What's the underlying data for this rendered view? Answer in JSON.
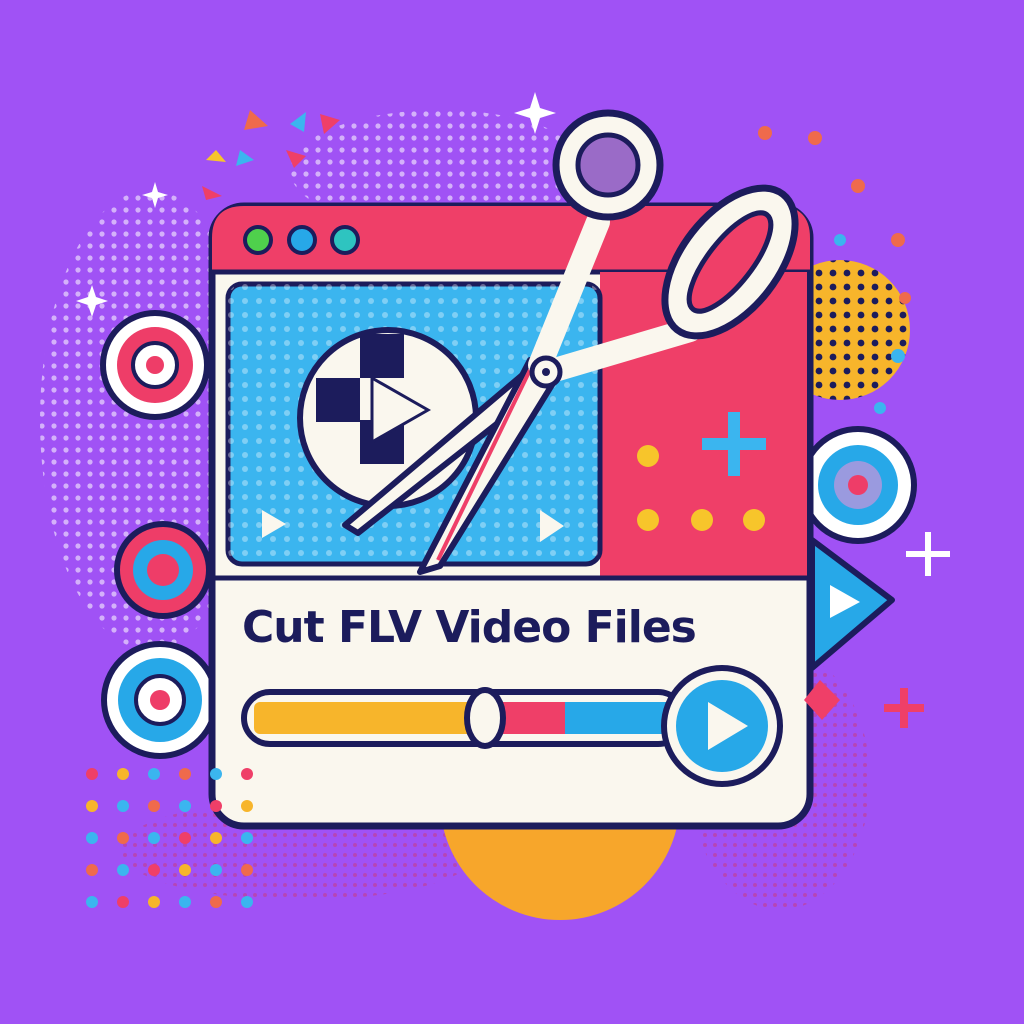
{
  "title": "Cut FLV Video Files",
  "progress": {
    "value": 0.55
  },
  "icons": {
    "scissors": "scissors-icon",
    "play_large": "play-circle-icon",
    "play_button": "play-button-icon",
    "window_dots": [
      "window-dot-green",
      "window-dot-blue",
      "window-dot-teal"
    ],
    "side_reels": "film-reel-icon",
    "plus": "plus-icon"
  },
  "colors": {
    "background": "#a052f5",
    "window_titlebar": "#ef3f68",
    "window_body": "#faf7ee",
    "video_panel": "#3bb5ef",
    "outline": "#1c1c5c",
    "accent_yellow": "#f7b52b",
    "accent_pink": "#ee3d68",
    "accent_blue": "#27a8e8"
  }
}
